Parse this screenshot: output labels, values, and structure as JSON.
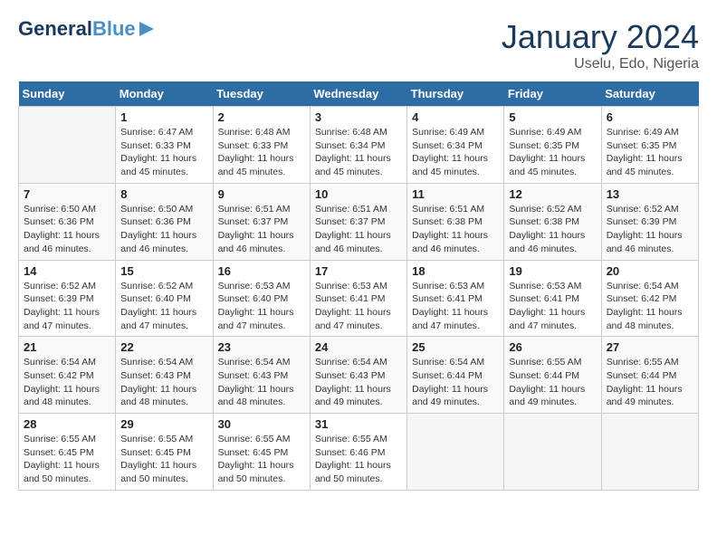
{
  "logo": {
    "line1": "General",
    "line2": "Blue",
    "icon": "▶"
  },
  "title": "January 2024",
  "subtitle": "Uselu, Edo, Nigeria",
  "days_of_week": [
    "Sunday",
    "Monday",
    "Tuesday",
    "Wednesday",
    "Thursday",
    "Friday",
    "Saturday"
  ],
  "weeks": [
    [
      {
        "day": "",
        "info": ""
      },
      {
        "day": "1",
        "info": "Sunrise: 6:47 AM\nSunset: 6:33 PM\nDaylight: 11 hours\nand 45 minutes."
      },
      {
        "day": "2",
        "info": "Sunrise: 6:48 AM\nSunset: 6:33 PM\nDaylight: 11 hours\nand 45 minutes."
      },
      {
        "day": "3",
        "info": "Sunrise: 6:48 AM\nSunset: 6:34 PM\nDaylight: 11 hours\nand 45 minutes."
      },
      {
        "day": "4",
        "info": "Sunrise: 6:49 AM\nSunset: 6:34 PM\nDaylight: 11 hours\nand 45 minutes."
      },
      {
        "day": "5",
        "info": "Sunrise: 6:49 AM\nSunset: 6:35 PM\nDaylight: 11 hours\nand 45 minutes."
      },
      {
        "day": "6",
        "info": "Sunrise: 6:49 AM\nSunset: 6:35 PM\nDaylight: 11 hours\nand 45 minutes."
      }
    ],
    [
      {
        "day": "7",
        "info": "Sunrise: 6:50 AM\nSunset: 6:36 PM\nDaylight: 11 hours\nand 46 minutes."
      },
      {
        "day": "8",
        "info": "Sunrise: 6:50 AM\nSunset: 6:36 PM\nDaylight: 11 hours\nand 46 minutes."
      },
      {
        "day": "9",
        "info": "Sunrise: 6:51 AM\nSunset: 6:37 PM\nDaylight: 11 hours\nand 46 minutes."
      },
      {
        "day": "10",
        "info": "Sunrise: 6:51 AM\nSunset: 6:37 PM\nDaylight: 11 hours\nand 46 minutes."
      },
      {
        "day": "11",
        "info": "Sunrise: 6:51 AM\nSunset: 6:38 PM\nDaylight: 11 hours\nand 46 minutes."
      },
      {
        "day": "12",
        "info": "Sunrise: 6:52 AM\nSunset: 6:38 PM\nDaylight: 11 hours\nand 46 minutes."
      },
      {
        "day": "13",
        "info": "Sunrise: 6:52 AM\nSunset: 6:39 PM\nDaylight: 11 hours\nand 46 minutes."
      }
    ],
    [
      {
        "day": "14",
        "info": "Sunrise: 6:52 AM\nSunset: 6:39 PM\nDaylight: 11 hours\nand 47 minutes."
      },
      {
        "day": "15",
        "info": "Sunrise: 6:52 AM\nSunset: 6:40 PM\nDaylight: 11 hours\nand 47 minutes."
      },
      {
        "day": "16",
        "info": "Sunrise: 6:53 AM\nSunset: 6:40 PM\nDaylight: 11 hours\nand 47 minutes."
      },
      {
        "day": "17",
        "info": "Sunrise: 6:53 AM\nSunset: 6:41 PM\nDaylight: 11 hours\nand 47 minutes."
      },
      {
        "day": "18",
        "info": "Sunrise: 6:53 AM\nSunset: 6:41 PM\nDaylight: 11 hours\nand 47 minutes."
      },
      {
        "day": "19",
        "info": "Sunrise: 6:53 AM\nSunset: 6:41 PM\nDaylight: 11 hours\nand 47 minutes."
      },
      {
        "day": "20",
        "info": "Sunrise: 6:54 AM\nSunset: 6:42 PM\nDaylight: 11 hours\nand 48 minutes."
      }
    ],
    [
      {
        "day": "21",
        "info": "Sunrise: 6:54 AM\nSunset: 6:42 PM\nDaylight: 11 hours\nand 48 minutes."
      },
      {
        "day": "22",
        "info": "Sunrise: 6:54 AM\nSunset: 6:43 PM\nDaylight: 11 hours\nand 48 minutes."
      },
      {
        "day": "23",
        "info": "Sunrise: 6:54 AM\nSunset: 6:43 PM\nDaylight: 11 hours\nand 48 minutes."
      },
      {
        "day": "24",
        "info": "Sunrise: 6:54 AM\nSunset: 6:43 PM\nDaylight: 11 hours\nand 49 minutes."
      },
      {
        "day": "25",
        "info": "Sunrise: 6:54 AM\nSunset: 6:44 PM\nDaylight: 11 hours\nand 49 minutes."
      },
      {
        "day": "26",
        "info": "Sunrise: 6:55 AM\nSunset: 6:44 PM\nDaylight: 11 hours\nand 49 minutes."
      },
      {
        "day": "27",
        "info": "Sunrise: 6:55 AM\nSunset: 6:44 PM\nDaylight: 11 hours\nand 49 minutes."
      }
    ],
    [
      {
        "day": "28",
        "info": "Sunrise: 6:55 AM\nSunset: 6:45 PM\nDaylight: 11 hours\nand 50 minutes."
      },
      {
        "day": "29",
        "info": "Sunrise: 6:55 AM\nSunset: 6:45 PM\nDaylight: 11 hours\nand 50 minutes."
      },
      {
        "day": "30",
        "info": "Sunrise: 6:55 AM\nSunset: 6:45 PM\nDaylight: 11 hours\nand 50 minutes."
      },
      {
        "day": "31",
        "info": "Sunrise: 6:55 AM\nSunset: 6:46 PM\nDaylight: 11 hours\nand 50 minutes."
      },
      {
        "day": "",
        "info": ""
      },
      {
        "day": "",
        "info": ""
      },
      {
        "day": "",
        "info": ""
      }
    ]
  ]
}
